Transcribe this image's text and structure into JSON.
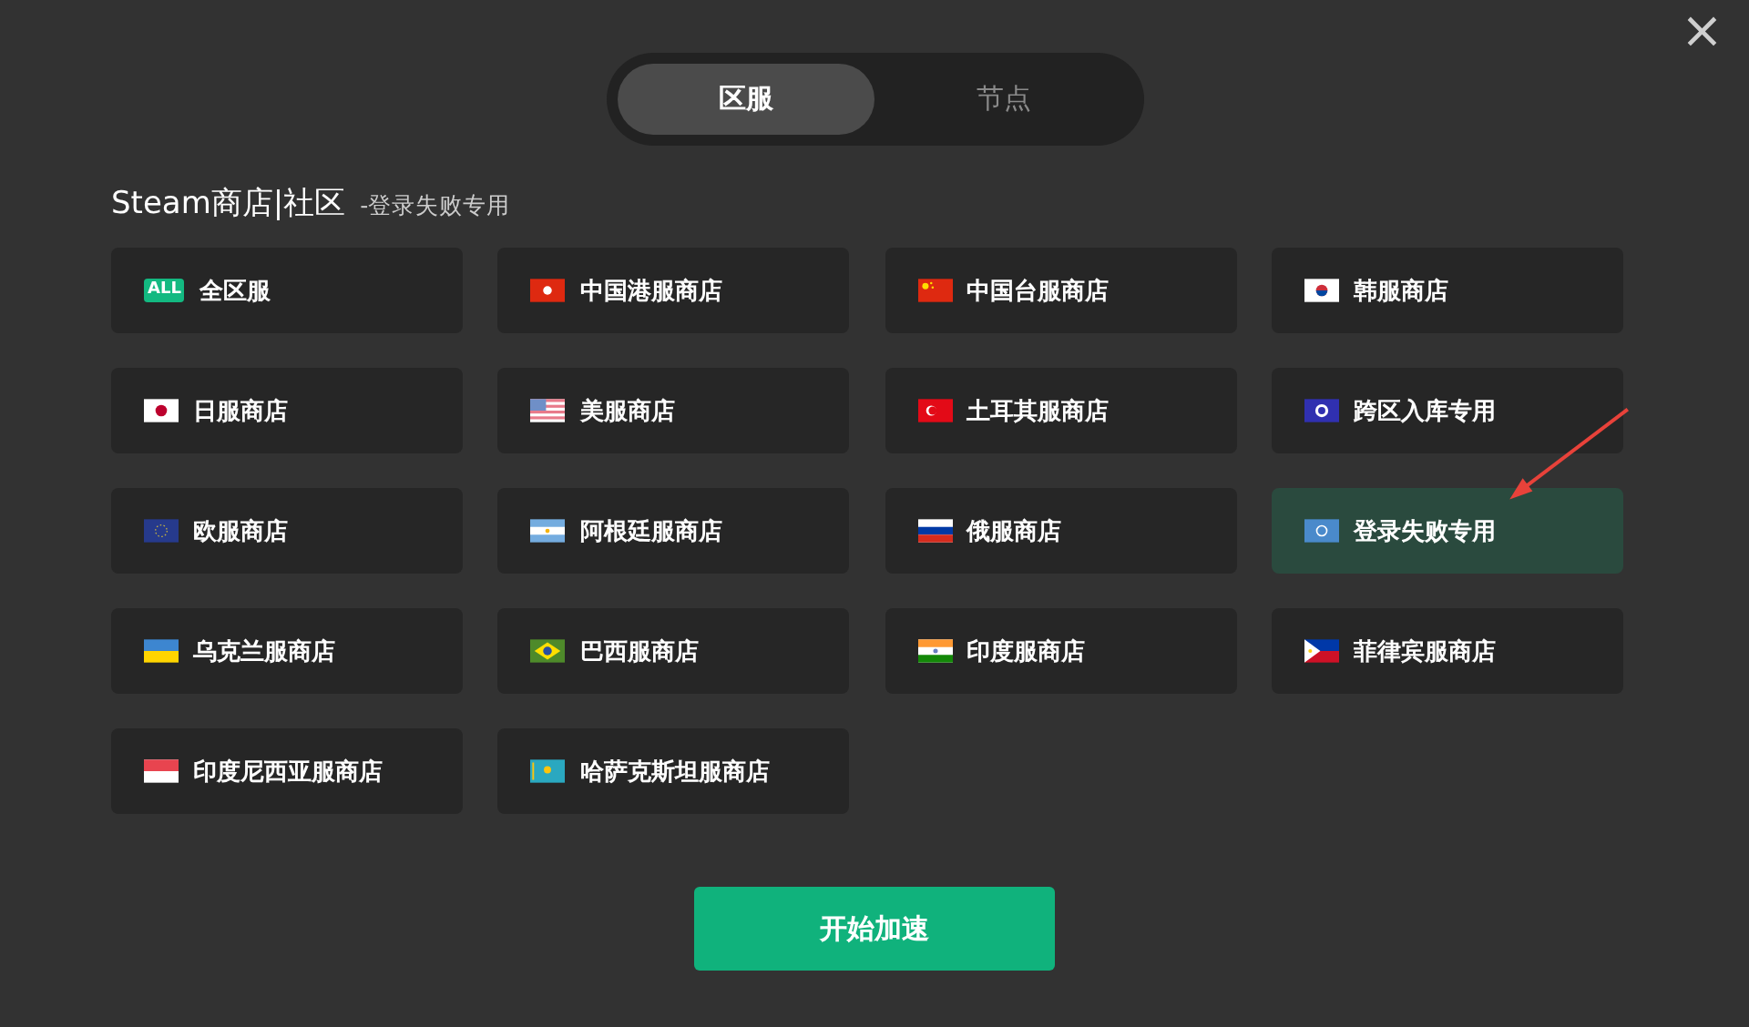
{
  "close": "×",
  "tabs": [
    {
      "label": "区服",
      "selected": true
    },
    {
      "label": "节点",
      "selected": false
    }
  ],
  "heading": {
    "title": "Steam商店|社区",
    "subtitle": "-登录失败专用"
  },
  "regions": [
    {
      "kind": "all",
      "badge": "ALL",
      "label": "全区服",
      "selected": false
    },
    {
      "kind": "hk",
      "label": "中国港服商店",
      "selected": false
    },
    {
      "kind": "cn",
      "label": "中国台服商店",
      "selected": false
    },
    {
      "kind": "kr",
      "label": "韩服商店",
      "selected": false
    },
    {
      "kind": "jp",
      "label": "日服商店",
      "selected": false
    },
    {
      "kind": "us",
      "label": "美服商店",
      "selected": false
    },
    {
      "kind": "tr",
      "label": "土耳其服商店",
      "selected": false
    },
    {
      "kind": "globe",
      "label": "跨区入库专用",
      "selected": false
    },
    {
      "kind": "eu",
      "label": "欧服商店",
      "selected": false
    },
    {
      "kind": "ar",
      "label": "阿根廷服商店",
      "selected": false
    },
    {
      "kind": "ru",
      "label": "俄服商店",
      "selected": false
    },
    {
      "kind": "un",
      "label": "登录失败专用",
      "selected": true
    },
    {
      "kind": "ua",
      "label": "乌克兰服商店",
      "selected": false
    },
    {
      "kind": "br",
      "label": "巴西服商店",
      "selected": false
    },
    {
      "kind": "in",
      "label": "印度服商店",
      "selected": false
    },
    {
      "kind": "ph",
      "label": "菲律宾服商店",
      "selected": false
    },
    {
      "kind": "id",
      "label": "印度尼西亚服商店",
      "selected": false
    },
    {
      "kind": "kz",
      "label": "哈萨克斯坦服商店",
      "selected": false
    }
  ],
  "start_button": "开始加速"
}
